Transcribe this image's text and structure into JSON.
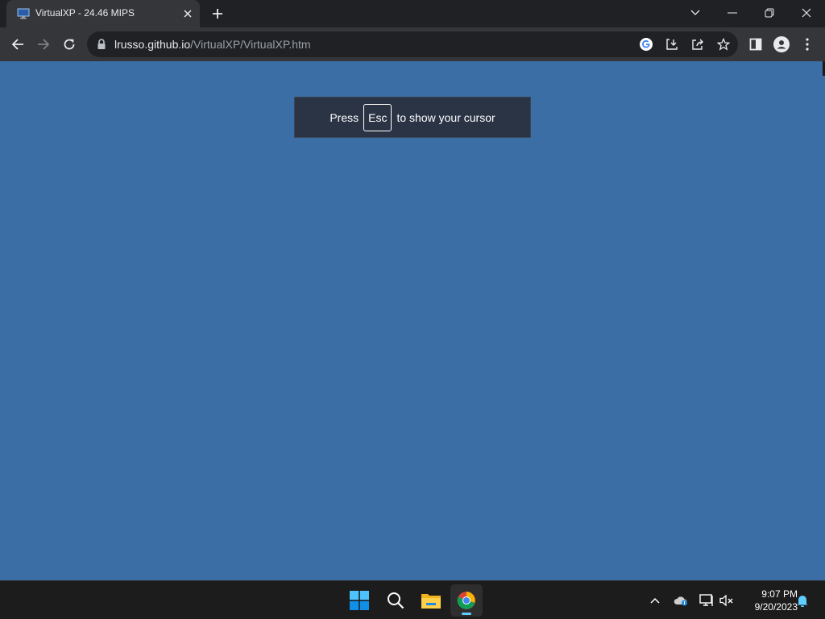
{
  "browser": {
    "tab": {
      "title": "VirtualXP - 24.46 MIPS",
      "favicon": "computer-monitor-icon"
    },
    "url": {
      "host": "lrusso.github.io",
      "path": "/VirtualXP/VirtualXP.htm"
    }
  },
  "content": {
    "background_color": "#3b6ea5",
    "esc_banner": {
      "press": "Press",
      "key": "Esc",
      "suffix": "to show your cursor"
    }
  },
  "taskbar": {
    "apps": [
      "windows-start",
      "search",
      "file-explorer",
      "google-chrome"
    ],
    "active_app": "google-chrome",
    "clock": {
      "time": "9:07 PM",
      "date": "9/20/2023"
    }
  },
  "colors": {
    "accent": "#60cdff",
    "tab_bg": "#35363a",
    "frame_bg": "#202124"
  }
}
